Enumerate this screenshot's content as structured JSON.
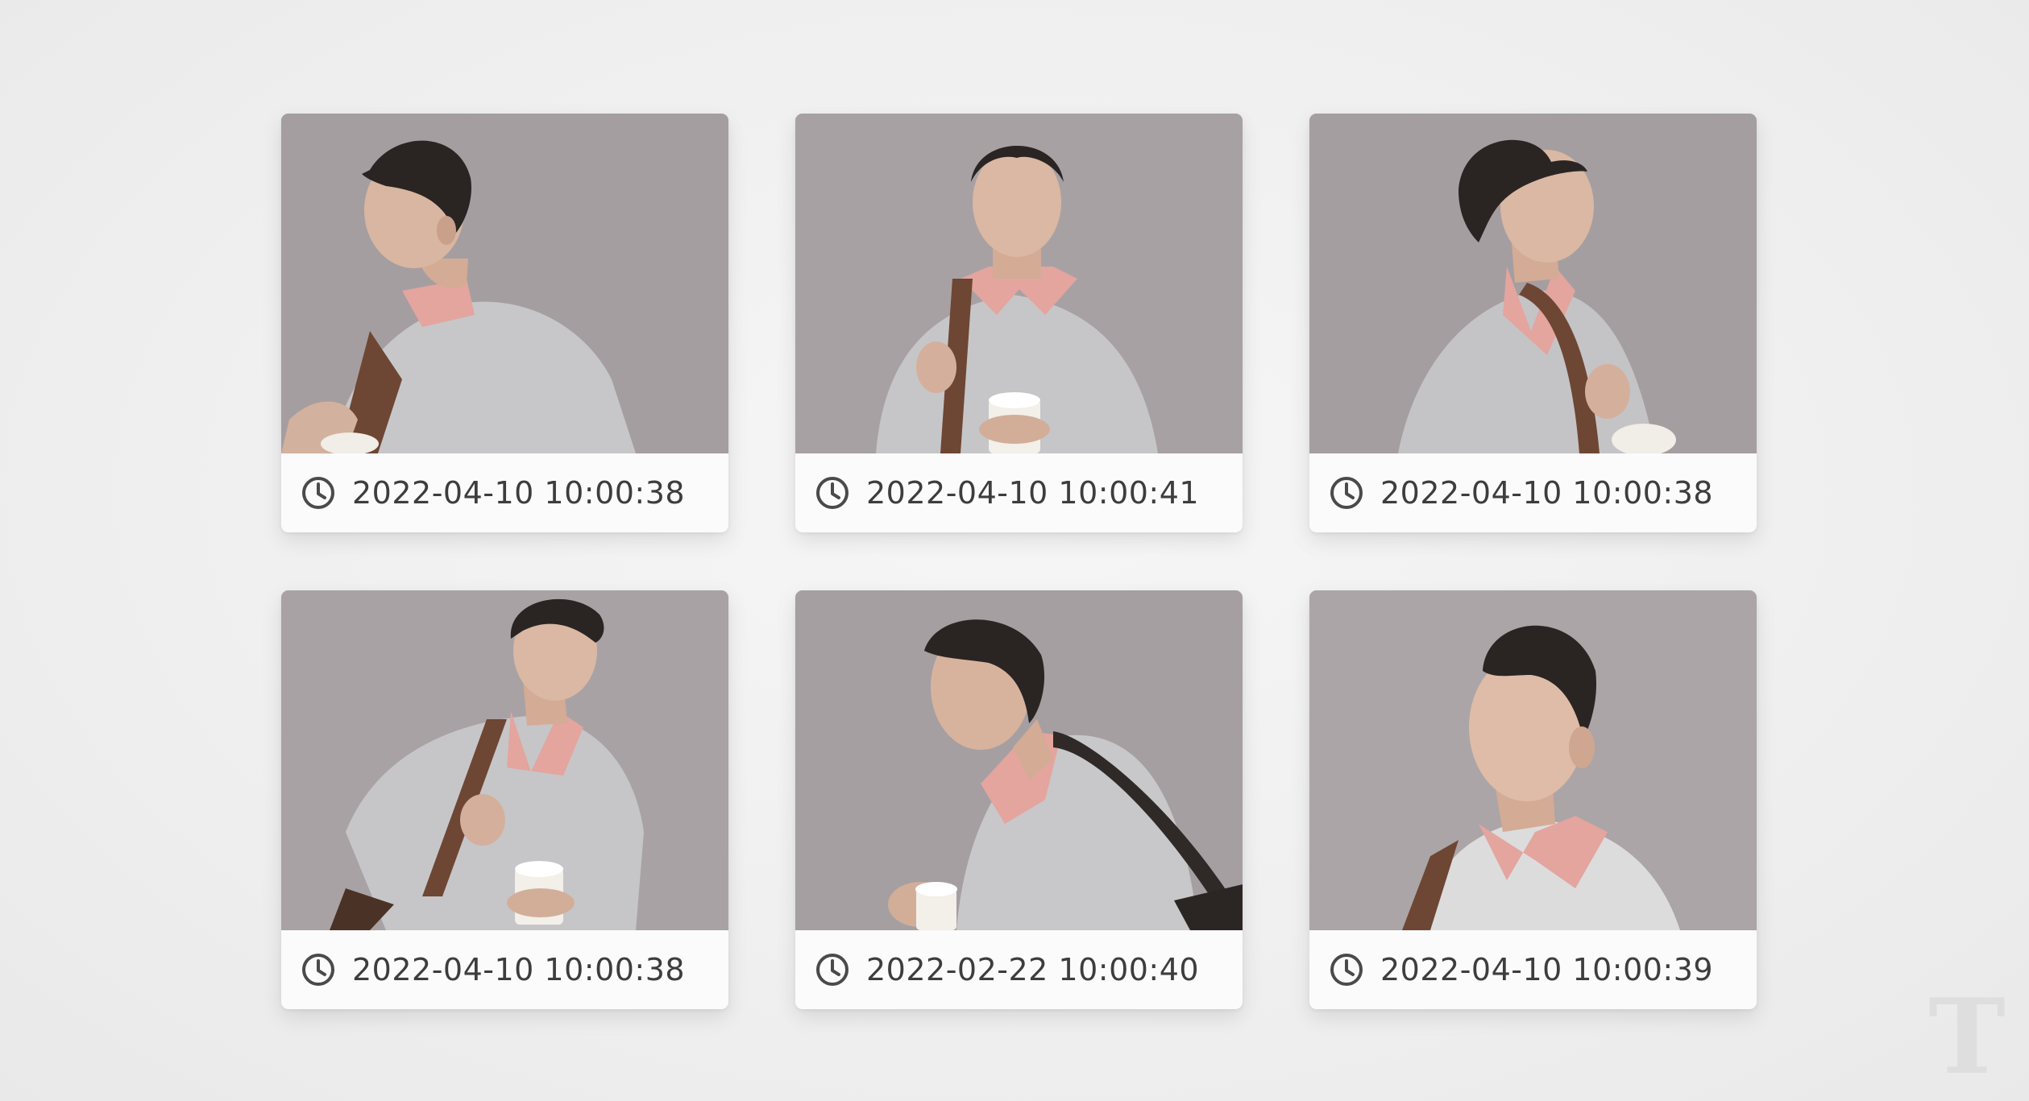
{
  "colors": {
    "background": "#efefef",
    "card": "#fbfbfb",
    "text": "#3d3d3d",
    "backdrop": "#a79fa2",
    "sweater": "#c4c4c6",
    "shirt": "#e3a59e",
    "hair": "#2a2523",
    "skin": "#d9b6a1",
    "strap": "#6e4634"
  },
  "cards": [
    {
      "timestamp": "2022-04-10 10:00:38",
      "icon": "clock-icon",
      "pose": "profile-left"
    },
    {
      "timestamp": "2022-04-10 10:00:41",
      "icon": "clock-icon",
      "pose": "front-cup"
    },
    {
      "timestamp": "2022-04-10 10:00:38",
      "icon": "clock-icon",
      "pose": "profile-right"
    },
    {
      "timestamp": "2022-04-10 10:00:38",
      "icon": "clock-icon",
      "pose": "glance-back-cup"
    },
    {
      "timestamp": "2022-02-22 10:00:40",
      "icon": "clock-icon",
      "pose": "turned-away-cup"
    },
    {
      "timestamp": "2022-04-10 10:00:39",
      "icon": "clock-icon",
      "pose": "three-quarter-right"
    }
  ],
  "watermark": {
    "text": "T",
    "icon": "publication-logo"
  }
}
